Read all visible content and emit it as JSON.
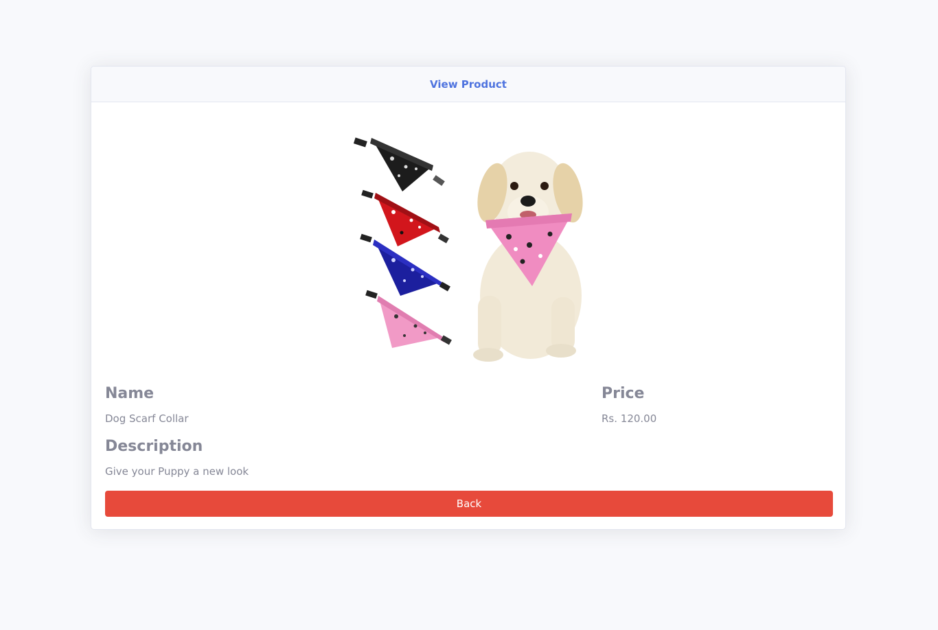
{
  "header": {
    "title": "View Product"
  },
  "product": {
    "image_alt": "Dog Scarf Collar product image",
    "name_label": "Name",
    "name_value": "Dog Scarf Collar",
    "price_label": "Price",
    "price_value": "Rs. 120.00",
    "description_label": "Description",
    "description_value": "Give your Puppy a new look"
  },
  "actions": {
    "back_label": "Back"
  },
  "colors": {
    "accent": "#4e73df",
    "danger": "#e74a3b",
    "muted_text": "#858796",
    "page_bg": "#f8f9fc"
  }
}
